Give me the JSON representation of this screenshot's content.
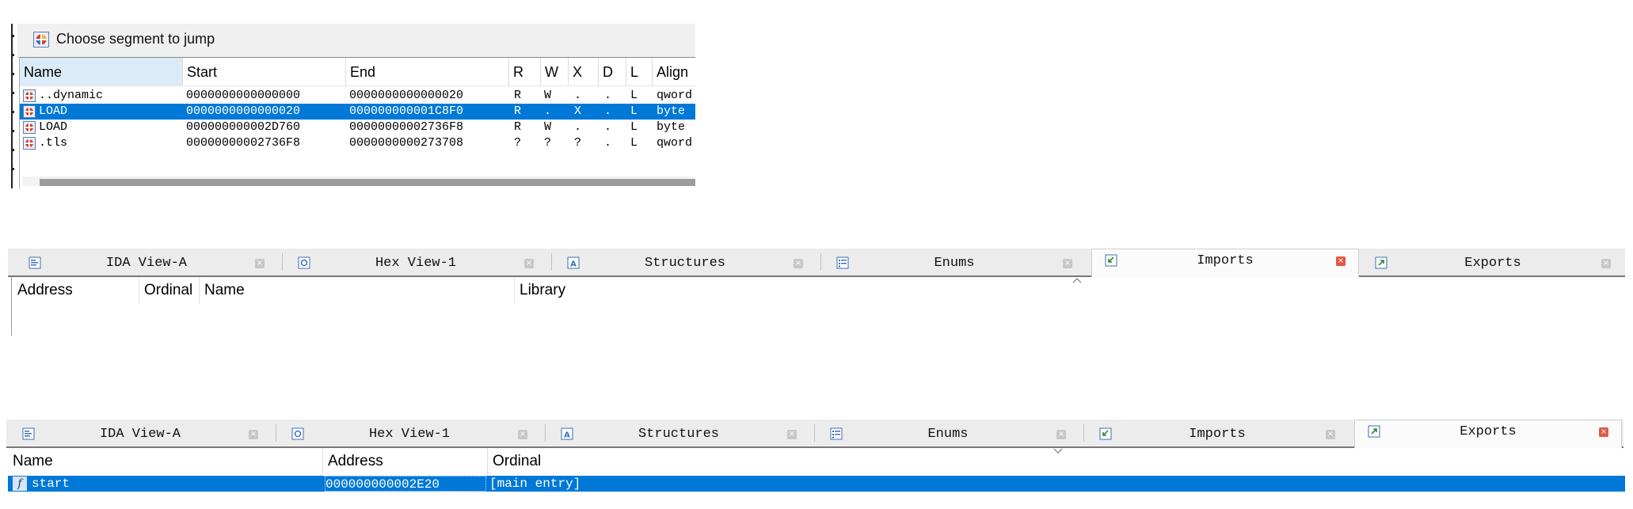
{
  "segment_dialog": {
    "title": "Choose segment to jump",
    "columns": [
      "Name",
      "Start",
      "End",
      "R",
      "W",
      "X",
      "D",
      "L",
      "Align"
    ],
    "rows": [
      {
        "name": "..dynamic",
        "start": "0000000000000000",
        "end": "0000000000000020",
        "r": "R",
        "w": "W",
        "x": ".",
        "d": ".",
        "l": "L",
        "align": "qword",
        "selected": false
      },
      {
        "name": "LOAD",
        "start": "0000000000000020",
        "end": "000000000001C8F0",
        "r": "R",
        "w": ".",
        "x": "X",
        "d": ".",
        "l": "L",
        "align": "byte",
        "selected": true
      },
      {
        "name": "LOAD",
        "start": "000000000002D760",
        "end": "00000000002736F8",
        "r": "R",
        "w": "W",
        "x": ".",
        "d": ".",
        "l": "L",
        "align": "byte",
        "selected": false
      },
      {
        "name": ".tls",
        "start": "00000000002736F8",
        "end": "0000000000273708",
        "r": "?",
        "w": "?",
        "x": "?",
        "d": ".",
        "l": "L",
        "align": "qword",
        "selected": false
      }
    ]
  },
  "tabs_top": [
    {
      "label": "IDA View-A",
      "icon": "ida-view-icon",
      "active": false
    },
    {
      "label": "Hex View-1",
      "icon": "hex-view-icon",
      "active": false
    },
    {
      "label": "Structures",
      "icon": "structures-icon",
      "active": false
    },
    {
      "label": "Enums",
      "icon": "enums-icon",
      "active": false
    },
    {
      "label": "Imports",
      "icon": "imports-icon",
      "active": true
    },
    {
      "label": "Exports",
      "icon": "exports-icon",
      "active": false
    }
  ],
  "imports_pane": {
    "columns": [
      "Address",
      "Ordinal",
      "Name",
      "Library"
    ]
  },
  "tabs_bottom": [
    {
      "label": "IDA View-A",
      "icon": "ida-view-icon",
      "active": false
    },
    {
      "label": "Hex View-1",
      "icon": "hex-view-icon",
      "active": false
    },
    {
      "label": "Structures",
      "icon": "structures-icon",
      "active": false
    },
    {
      "label": "Enums",
      "icon": "enums-icon",
      "active": false
    },
    {
      "label": "Imports",
      "icon": "imports-icon",
      "active": false
    },
    {
      "label": "Exports",
      "icon": "exports-icon",
      "active": true
    }
  ],
  "exports_pane": {
    "columns": [
      "Name",
      "Address",
      "Ordinal"
    ],
    "rows": [
      {
        "icon": "function-icon",
        "name": "start",
        "address": "000000000002E20",
        "ordinal": "[main entry]",
        "selected": true
      }
    ]
  },
  "colors": {
    "selection": "#0078d7",
    "active_close": "#e25745",
    "tab_strip": "#ececec"
  }
}
